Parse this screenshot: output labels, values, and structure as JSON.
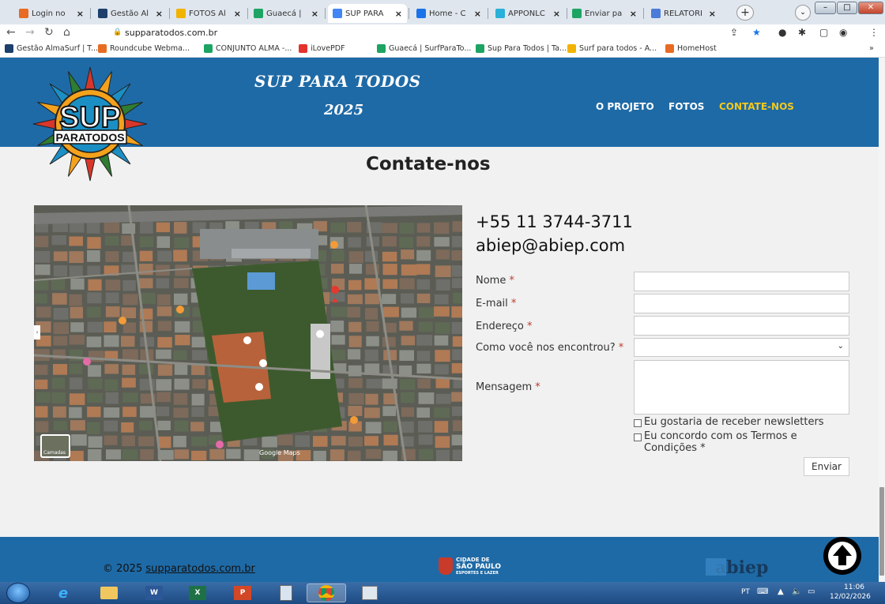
{
  "browser": {
    "tabs": [
      {
        "label": "Login no",
        "color": "#e86b23"
      },
      {
        "label": "Gestão Al",
        "color": "#1d3f6b"
      },
      {
        "label": "FOTOS Al",
        "color": "#f2b300"
      },
      {
        "label": "Guaecá | ",
        "color": "#1da462"
      },
      {
        "label": "SUP PARA",
        "color": "#4285f4"
      },
      {
        "label": "Home - C",
        "color": "#1a73e8"
      },
      {
        "label": "APPONLC",
        "color": "#2ab0d9"
      },
      {
        "label": "Enviar pa",
        "color": "#1da462"
      },
      {
        "label": "RELATÓRI",
        "color": "#4a7bd8"
      }
    ],
    "new_tab": "+",
    "tab_menu": "⌄",
    "window_controls": {
      "minimize": "–",
      "maximize": "□",
      "close": "✕"
    },
    "url": "supparatodos.com.br",
    "bookmarks": [
      {
        "label": "Gestão AlmaSurf | T...",
        "color": "#1d3f6b"
      },
      {
        "label": "Roundcube Webma...",
        "color": "#e86b23"
      },
      {
        "label": "CONJUNTO ALMA -...",
        "color": "#1da462"
      },
      {
        "label": "iLovePDF",
        "color": "#e5322d"
      },
      {
        "label": "Guaecá | SurfParaTo...",
        "color": "#1da462"
      },
      {
        "label": "Sup Para Todos | Ta...",
        "color": "#1da462"
      },
      {
        "label": "Surf para todos - A...",
        "color": "#f2b300"
      },
      {
        "label": "HomeHost",
        "color": "#e86b23"
      }
    ],
    "bookmarks_more": "»"
  },
  "site": {
    "logo_text_top": "SUP",
    "logo_text_bottom": "PARATODOS",
    "title": "SUP PARA TODOS",
    "year": "2025",
    "nav": [
      {
        "label": "O PROJETO",
        "active": false
      },
      {
        "label": "FOTOS",
        "active": false
      },
      {
        "label": "CONTATE-NOS",
        "active": true
      }
    ]
  },
  "contact": {
    "heading": "Contate-nos",
    "phone": "+55 11 3744-3711",
    "email": "abiep@abiep.com",
    "map": {
      "attribution": "Google Maps",
      "layer_label": "Camadas"
    },
    "form": {
      "name_label": "Nome",
      "email_label": "E-mail",
      "address_label": "Endereço",
      "found_label": "Como você nos encontrou?",
      "message_label": "Mensagem",
      "required_mark": "*",
      "newsletter_label": "Eu gostaria de receber newsletters",
      "terms_label": "Eu concordo com os Termos e Condições",
      "submit_label": "Enviar"
    }
  },
  "footer": {
    "copyright_prefix": "© 2025 ",
    "copyright_link": "supparatodos.com.br",
    "sp_logo_line1": "CIDADE DE",
    "sp_logo_line2": "SÃO PAULO",
    "sp_logo_line3": "ESPORTES E LAZER",
    "abiep_logo": "abiep"
  },
  "taskbar": {
    "lang": "PT",
    "time": "11:06",
    "date": "12/02/2026"
  },
  "colors": {
    "brand_blue": "#1e6aa6",
    "nav_active": "#f5c81c",
    "required": "#c0392b"
  }
}
